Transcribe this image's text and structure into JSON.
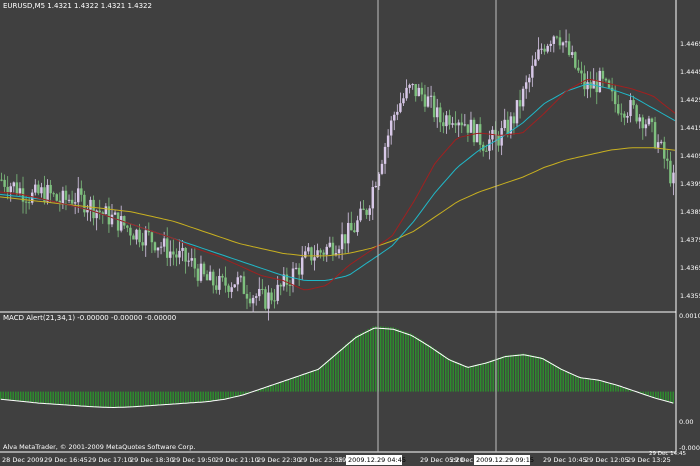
{
  "main_title": "EURUSD,M5  1.4321 1.4322 1.4321 1.4322",
  "indicator_title": "MACD Alert(21,34,1) -0.00000 -0.00000 -0.00000",
  "copyright": "Alva MetaTrader, © 2001-2009 MetaQuotes Software Corp.",
  "colors": {
    "background": "#404040",
    "bull_candle": "#d8c8e8",
    "bear_candle": "#7ec07e",
    "ma_fast": "#a02020",
    "ma_mid": "#20b8c8",
    "ma_slow": "#c8b020",
    "macd_hist": "#2e8a2e",
    "signal_line": "#ffffff",
    "crosshair": "#c0c0c0",
    "grid_separator": "#ffffff"
  },
  "price_axis": {
    "labels": [
      "1.4465",
      "1.4445",
      "1.4425",
      "1.4415",
      "1.4405",
      "1.4395",
      "1.4385",
      "1.4375",
      "1.4365",
      "1.4355"
    ]
  },
  "macd_axis": {
    "labels": [
      "0.00103",
      "0.00",
      "-0.00089"
    ]
  },
  "time_axis": {
    "labels": [
      "28 Dec 2009",
      "29 Dec 16:45",
      "29 Dec 17:10",
      "29 Dec 18:30",
      "29 Dec 19:50",
      "29 Dec 21:10",
      "29 Dec 22:30",
      "29 Dec 23:35",
      "29 Dec 01:15",
      "29 Dec 02:30",
      "29 Dec 05:20",
      "29 Dec 06:45",
      "29 Dec 10:45",
      "29 Dec 12:05",
      "29 Dec 13:25",
      "29 Dec 14:45"
    ],
    "crosshair_tags": [
      "2009.12.29 04:45",
      "2009.12.29 09:15"
    ]
  },
  "chart_data": {
    "type": "candlestick",
    "symbol": "EURUSD",
    "timeframe": "M5",
    "y_price_range": [
      1.4348,
      1.447
    ],
    "price_path": [
      1.4401,
      1.4398,
      1.4394,
      1.4396,
      1.4392,
      1.4394,
      1.4391,
      1.4387,
      1.4384,
      1.438,
      1.4378,
      1.4374,
      1.437,
      1.4367,
      1.436,
      1.4358,
      1.436,
      1.4355,
      1.4352,
      1.4356,
      1.4363,
      1.437,
      1.4372,
      1.4376,
      1.438,
      1.4389,
      1.441,
      1.443,
      1.4438,
      1.4435,
      1.4425,
      1.4428,
      1.4423,
      1.4416,
      1.4418,
      1.4425,
      1.444,
      1.4455,
      1.4462,
      1.445,
      1.4438,
      1.4441,
      1.4432,
      1.443,
      1.4426,
      1.4415,
      1.44
    ],
    "ma_fast_path": [
      1.4396,
      1.4395,
      1.4393,
      1.4391,
      1.4389,
      1.4386,
      1.4383,
      1.438,
      1.4377,
      1.4373,
      1.437,
      1.4366,
      1.4362,
      1.436,
      1.4356,
      1.4358,
      1.4366,
      1.4372,
      1.4378,
      1.4392,
      1.4408,
      1.4418,
      1.442,
      1.4419,
      1.442,
      1.4428,
      1.4437,
      1.4442,
      1.444,
      1.4438,
      1.4435,
      1.4428
    ],
    "ma_mid_path": [
      1.4395,
      1.4394,
      1.4393,
      1.4391,
      1.4389,
      1.4386,
      1.4383,
      1.438,
      1.4377,
      1.4374,
      1.4371,
      1.4368,
      1.4365,
      1.4362,
      1.436,
      1.436,
      1.4362,
      1.4368,
      1.4374,
      1.4384,
      1.4396,
      1.4406,
      1.4413,
      1.4418,
      1.4424,
      1.4432,
      1.4437,
      1.444,
      1.4438,
      1.4435,
      1.443,
      1.4425
    ],
    "ma_slow_path": [
      1.4394,
      1.4393,
      1.4392,
      1.4391,
      1.439,
      1.4389,
      1.4388,
      1.4386,
      1.4384,
      1.4381,
      1.4378,
      1.4375,
      1.4373,
      1.4371,
      1.437,
      1.437,
      1.4371,
      1.4373,
      1.4376,
      1.438,
      1.4386,
      1.4392,
      1.4396,
      1.4399,
      1.4402,
      1.4406,
      1.4409,
      1.4411,
      1.4413,
      1.4414,
      1.4414,
      1.4413
    ],
    "macd_range": [
      -0.00089,
      0.00103
    ],
    "macd_path": [
      -0.00012,
      -0.00015,
      -0.00018,
      -0.0002,
      -0.00022,
      -0.00024,
      -0.00025,
      -0.00024,
      -0.00022,
      -0.0002,
      -0.00018,
      -0.00016,
      -0.00012,
      -5e-05,
      5e-05,
      0.00015,
      0.00025,
      0.00035,
      0.0006,
      0.00085,
      0.001,
      0.00098,
      0.00088,
      0.0007,
      0.0005,
      0.00038,
      0.00045,
      0.00055,
      0.00058,
      0.00052,
      0.00035,
      0.00022,
      0.00018,
      0.0001,
      0.0,
      -0.0001,
      -0.00018
    ]
  }
}
